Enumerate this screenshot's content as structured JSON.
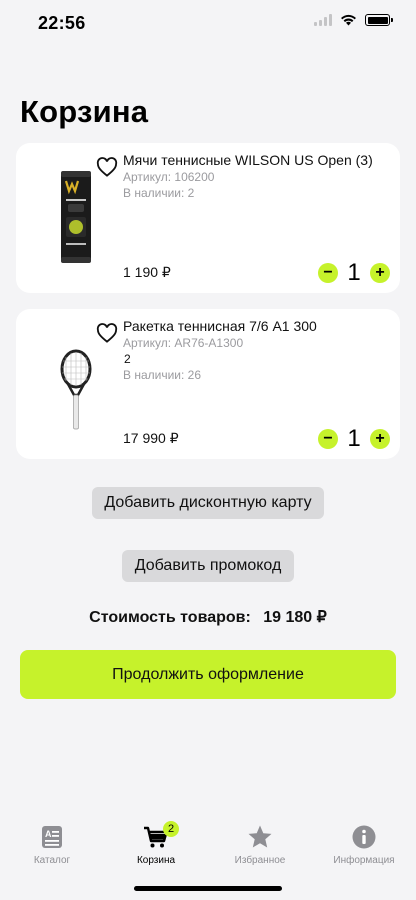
{
  "status_bar": {
    "time": "22:56"
  },
  "page": {
    "title": "Корзина"
  },
  "cart_items": [
    {
      "name": "Мячи теннисные WILSON US Open (3)",
      "article": "Артикул: 106200",
      "extra": "",
      "stock": "В наличии: 2",
      "price": "1 190 ₽",
      "quantity": "1",
      "image_icon": "tennis-balls-can-image"
    },
    {
      "name": "Ракетка теннисная 7/6 A1 300",
      "article": "Артикул: AR76-A1300",
      "extra": "2",
      "stock": "В наличии: 26",
      "price": "17 990 ₽",
      "quantity": "1",
      "image_icon": "tennis-racket-image"
    }
  ],
  "actions": {
    "discount_card": "Добавить дисконтную карту",
    "promo_code": "Добавить промокод",
    "checkout": "Продолжить оформление"
  },
  "total": {
    "label": "Стоимость товаров:",
    "value": "19 180 ₽"
  },
  "tabbar": {
    "items": [
      {
        "label": "Каталог",
        "icon": "catalog-icon"
      },
      {
        "label": "Корзина",
        "icon": "cart-icon",
        "badge": "2",
        "active": true
      },
      {
        "label": "Избранное",
        "icon": "star-icon"
      },
      {
        "label": "Информация",
        "icon": "info-icon"
      }
    ]
  },
  "colors": {
    "accent": "#c6f22b",
    "background": "#f4f4f6",
    "card": "#ffffff",
    "secondary_text": "#9b9b9f",
    "button_gray": "#d9d9db"
  }
}
